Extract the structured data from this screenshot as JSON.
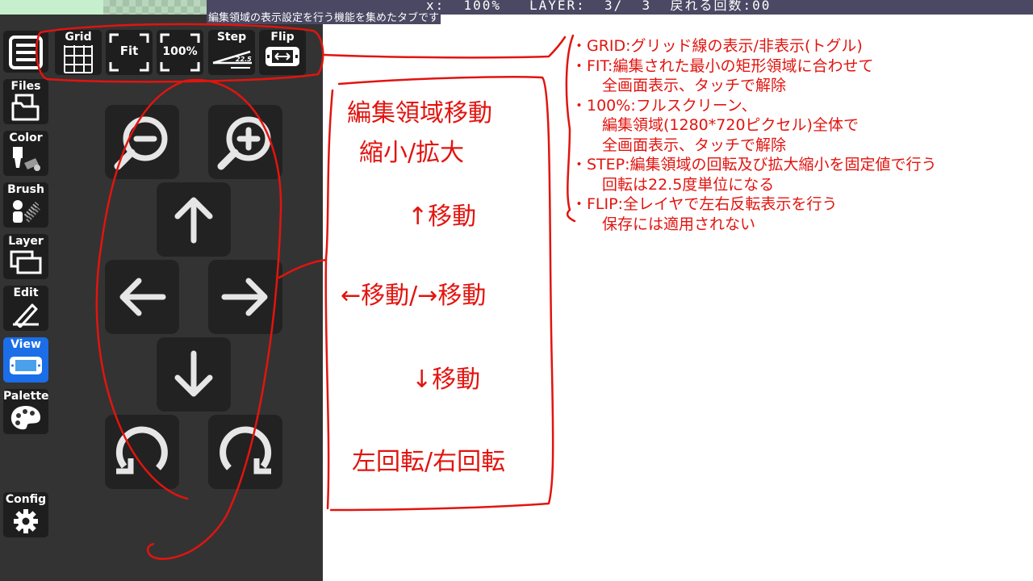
{
  "status_bar": {
    "text": "x:  100%   LAYER:  3/  3  戻れる回数:00"
  },
  "tooltip": "編集領域の表示設定を行う機能を集めたタブです",
  "sidebar": {
    "items": [
      {
        "label": "Files",
        "icon": "files-icon"
      },
      {
        "label": "Color",
        "icon": "color-icon"
      },
      {
        "label": "Brush",
        "icon": "brush-icon"
      },
      {
        "label": "Layer",
        "icon": "layer-icon"
      },
      {
        "label": "Edit",
        "icon": "edit-icon"
      },
      {
        "label": "View",
        "icon": "view-icon",
        "active": true
      },
      {
        "label": "Palette",
        "icon": "palette-icon"
      },
      {
        "label": "Config",
        "icon": "gear-icon"
      }
    ]
  },
  "toolbar": {
    "grid": "Grid",
    "fit": "Fit",
    "full": "100%",
    "step": "Step",
    "step_value": "22.5",
    "flip": "Flip"
  },
  "annotations": {
    "move_zone": "編集領域移動",
    "zoom": "縮小/拡大",
    "up": "↑移動",
    "left_right": "←移動/→移動",
    "down": "↓移動",
    "rotate": "左回転/右回転",
    "notes": [
      "・GRID:グリッド線の表示/非表示(トグル)",
      "・FIT:編集された最小の矩形領域に合わせて",
      "　　全画面表示、タッチで解除",
      "・100%:フルスクリーン、",
      "　　編集領域(1280*720ピクセル)全体で",
      "　　全画面表示、タッチで解除",
      "・STEP:編集領域の回転及び拡大縮小を固定値で行う",
      "　　回転は22.5度単位になる",
      "・FLIP:全レイヤで左右反転表示を行う",
      "　　保存には適用されない"
    ]
  },
  "colors": {
    "accent": "#1b6ee8",
    "annotation": "#e2140f",
    "panel": "#333333"
  }
}
